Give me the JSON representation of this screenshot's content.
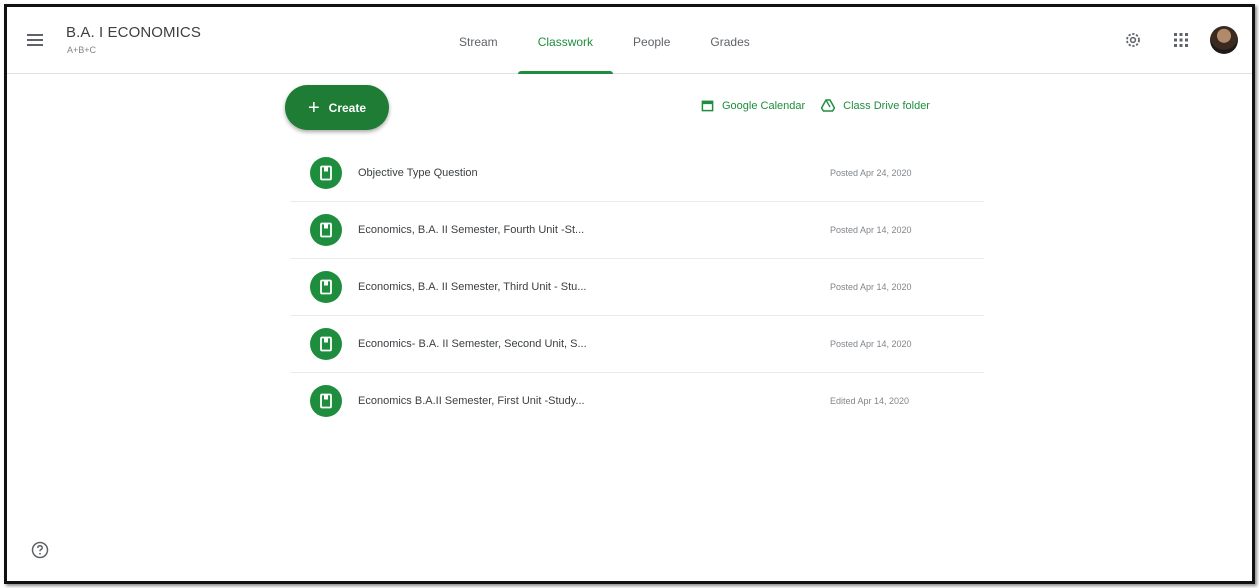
{
  "header": {
    "class_title": "B.A. I ECONOMICS",
    "class_section": "A+B+C",
    "tabs": [
      {
        "label": "Stream",
        "active": false
      },
      {
        "label": "Classwork",
        "active": true
      },
      {
        "label": "People",
        "active": false
      },
      {
        "label": "Grades",
        "active": false
      }
    ],
    "icons": [
      "menu-icon",
      "settings-gear-icon",
      "apps-grid-icon",
      "profile-avatar"
    ]
  },
  "toolbar": {
    "create_label": "Create",
    "calendar_label": "Google Calendar",
    "drive_label": "Class Drive folder"
  },
  "classwork": {
    "items": [
      {
        "title": "Objective Type Question",
        "date": "Posted Apr 24, 2020",
        "icon": "material-icon"
      },
      {
        "title": "Economics, B.A. II Semester, Fourth Unit -St...",
        "date": "Posted Apr 14, 2020",
        "icon": "material-icon"
      },
      {
        "title": "Economics, B.A. II Semester, Third Unit - Stu...",
        "date": "Posted Apr 14, 2020",
        "icon": "material-icon"
      },
      {
        "title": "Economics- B.A. II Semester, Second Unit, S...",
        "date": "Posted Apr 14, 2020",
        "icon": "material-icon"
      },
      {
        "title": "Economics B.A.II Semester, First Unit -Study...",
        "date": "Edited Apr 14, 2020",
        "icon": "material-icon"
      }
    ]
  },
  "colors": {
    "accent": "#1e8e3e",
    "create_button": "#1e7c34",
    "text": "#3c4043",
    "muted": "#80868b"
  }
}
